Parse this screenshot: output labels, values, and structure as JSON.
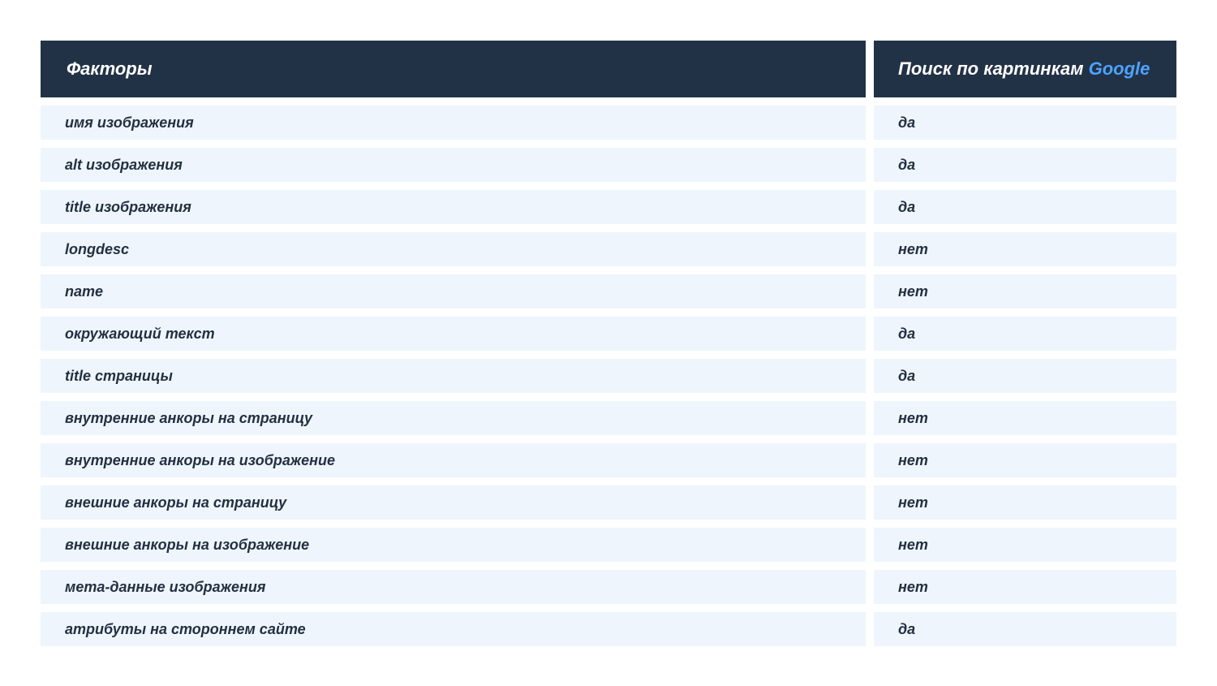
{
  "table": {
    "header": {
      "factors": "Факторы",
      "search_prefix": "Поиск по картинкам",
      "search_brand": "Google"
    },
    "rows": [
      {
        "factor": "имя изображения",
        "value": "да"
      },
      {
        "factor": "alt изображения",
        "value": "да"
      },
      {
        "factor": "title изображения",
        "value": "да"
      },
      {
        "factor": "longdesc",
        "value": "нет"
      },
      {
        "factor": "name",
        "value": "нет"
      },
      {
        "factor": "окружающий текст",
        "value": "да"
      },
      {
        "factor": "title страницы",
        "value": "да"
      },
      {
        "factor": "внутренние анкоры на страницу",
        "value": "нет"
      },
      {
        "factor": "внутренние анкоры на изображение",
        "value": "нет"
      },
      {
        "factor": "внешние анкоры на страницу",
        "value": "нет"
      },
      {
        "factor": "внешние анкоры на изображение",
        "value": "нет"
      },
      {
        "factor": "мета-данные изображения",
        "value": "нет"
      },
      {
        "factor": "атрибуты на стороннем сайте",
        "value": "да"
      }
    ]
  },
  "colors": {
    "header_bg": "#223246",
    "row_bg": "#eef5fd",
    "text": "#243041",
    "accent": "#4da3ff"
  }
}
